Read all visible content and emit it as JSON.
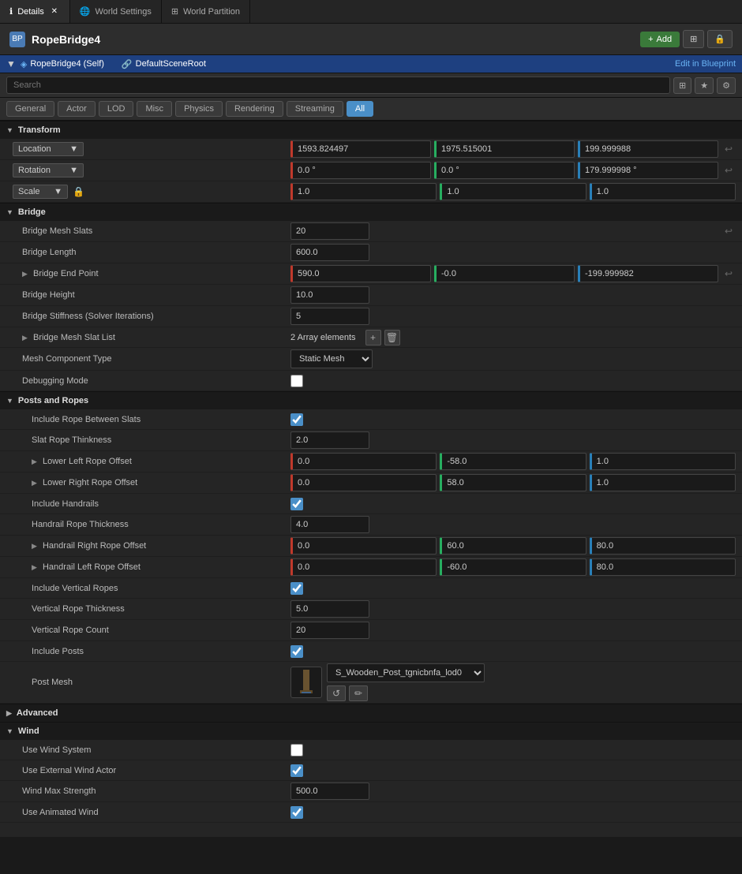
{
  "tabs": [
    {
      "id": "details",
      "label": "Details",
      "active": true,
      "icon": "ℹ",
      "closable": true
    },
    {
      "id": "world-settings",
      "label": "World Settings",
      "active": false,
      "icon": "🌐",
      "closable": false
    },
    {
      "id": "world-partition",
      "label": "World Partition",
      "active": false,
      "icon": "⊞",
      "closable": false
    }
  ],
  "actor": {
    "name": "RopeBridge4",
    "icon": "BP",
    "self_label": "RopeBridge4 (Self)",
    "scene_root": "DefaultSceneRoot",
    "edit_blueprint_label": "Edit in Blueprint",
    "add_label": "+ Add",
    "lock_label": "🔒"
  },
  "search": {
    "placeholder": "Search"
  },
  "filter_tabs": [
    {
      "label": "General"
    },
    {
      "label": "Actor"
    },
    {
      "label": "LOD"
    },
    {
      "label": "Misc"
    },
    {
      "label": "Physics"
    },
    {
      "label": "Rendering"
    },
    {
      "label": "Streaming"
    },
    {
      "label": "All",
      "active": true
    }
  ],
  "sections": {
    "transform": {
      "label": "Transform",
      "location": {
        "label": "Location",
        "x": "1593.824497",
        "y": "1975.515001",
        "z": "199.999988"
      },
      "rotation": {
        "label": "Rotation",
        "x": "0.0 °",
        "y": "0.0 °",
        "z": "179.999998 °"
      },
      "scale": {
        "label": "Scale",
        "x": "1.0",
        "y": "1.0",
        "z": "1.0"
      }
    },
    "bridge": {
      "label": "Bridge",
      "mesh_slats": {
        "label": "Bridge Mesh Slats",
        "value": "20"
      },
      "length": {
        "label": "Bridge Length",
        "value": "600.0"
      },
      "end_point": {
        "label": "Bridge End Point",
        "x": "590.0",
        "y": "-0.0",
        "z": "-199.999982"
      },
      "height": {
        "label": "Bridge Height",
        "value": "10.0"
      },
      "stiffness": {
        "label": "Bridge Stiffness (Solver Iterations)",
        "value": "5"
      },
      "mesh_slat_list": {
        "label": "Bridge Mesh Slat List",
        "value": "2 Array elements"
      },
      "mesh_component_type": {
        "label": "Mesh Component Type",
        "value": "Static Mesh"
      },
      "debugging_mode": {
        "label": "Debugging Mode"
      }
    },
    "posts_and_ropes": {
      "label": "Posts and Ropes",
      "include_rope": {
        "label": "Include Rope Between Slats"
      },
      "slat_rope_thickness": {
        "label": "Slat Rope Thinkness",
        "value": "2.0"
      },
      "lower_left_offset": {
        "label": "Lower Left Rope Offset",
        "x": "0.0",
        "y": "-58.0",
        "z": "1.0"
      },
      "lower_right_offset": {
        "label": "Lower Right Rope Offset",
        "x": "0.0",
        "y": "58.0",
        "z": "1.0"
      },
      "include_handrails": {
        "label": "Include Handrails"
      },
      "handrail_rope_thickness": {
        "label": "Handrail Rope Thickness",
        "value": "4.0"
      },
      "handrail_right_offset": {
        "label": "Handrail Right Rope Offset",
        "x": "0.0",
        "y": "60.0",
        "z": "80.0"
      },
      "handrail_left_offset": {
        "label": "Handrail Left Rope Offset",
        "x": "0.0",
        "y": "-60.0",
        "z": "80.0"
      },
      "include_vertical": {
        "label": "Include Vertical Ropes"
      },
      "vertical_thickness": {
        "label": "Vertical Rope Thickness",
        "value": "5.0"
      },
      "vertical_count": {
        "label": "Vertical Rope Count",
        "value": "20"
      },
      "include_posts": {
        "label": "Include Posts"
      },
      "post_mesh": {
        "label": "Post Mesh",
        "mesh_name": "S_Wooden_Post_tgnicbnfa_lod0"
      }
    },
    "advanced": {
      "label": "Advanced"
    },
    "wind": {
      "label": "Wind",
      "use_wind_system": {
        "label": "Use Wind System"
      },
      "use_external_wind": {
        "label": "Use External Wind Actor"
      },
      "wind_max_strength": {
        "label": "Wind Max Strength",
        "value": "500.0"
      },
      "use_animated_wind": {
        "label": "Use Animated Wind"
      }
    }
  }
}
